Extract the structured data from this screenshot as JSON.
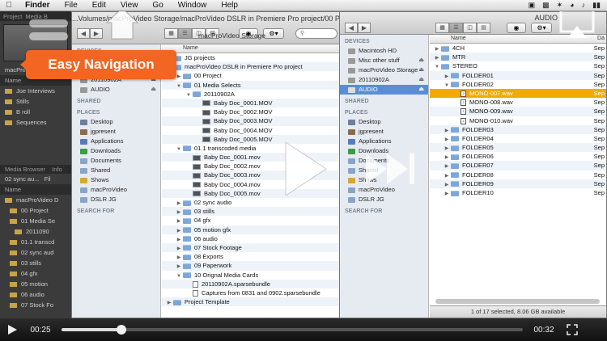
{
  "menubar": {
    "apple": "",
    "items": [
      "Finder",
      "File",
      "Edit",
      "View",
      "Go",
      "Window",
      "Help"
    ]
  },
  "premiere": {
    "tabs": [
      "Project",
      "Media B"
    ],
    "clip_label": "macProV...s in Premie",
    "name_header": "Name",
    "bins": [
      "Joe Interviews",
      "Stills",
      "B roll",
      "Sequences"
    ],
    "media_browser_tab": "Media Browser",
    "info_tab": "Info",
    "sync_dropdown": "02 sync au...",
    "filter_label": "Fil",
    "name_header2": "Name",
    "tree": [
      "macProVideo D",
      "00 Project",
      "01 Media Se",
      "2011090",
      "01.1 transcd",
      "02 sync aud",
      "03 stills",
      "04 gfx",
      "05 motion",
      "06 audio",
      "07 Stock Fo"
    ]
  },
  "finder1": {
    "path_title": "...Volumes/macProVideo Storage/macProVideo DSLR in Premiere Pro project/00 Proj",
    "title": "macProVideo Storage",
    "column_name": "Name",
    "sidebar": {
      "devices_label": "DEVICES",
      "devices": [
        "20110902A",
        "AUDIO"
      ],
      "shared_label": "SHARED",
      "places_label": "PLACES",
      "places": [
        "Desktop",
        "jgpresent",
        "Applications",
        "Downloads",
        "Documents",
        "Shared",
        "Shows",
        "macProVideo",
        "DSLR JG"
      ],
      "search_label": "SEARCH FOR"
    },
    "rows": [
      {
        "indent": 0,
        "tri": "▶",
        "icon": "folder",
        "label": "JG projects"
      },
      {
        "indent": 0,
        "tri": "▼",
        "icon": "folder",
        "label": "macProVideo DSLR in Premiere Pro project"
      },
      {
        "indent": 1,
        "tri": "▶",
        "icon": "folder",
        "label": "00 Project"
      },
      {
        "indent": 1,
        "tri": "▼",
        "icon": "folder",
        "label": "01 Media Selects"
      },
      {
        "indent": 2,
        "tri": "▼",
        "icon": "folder",
        "label": "20110902A"
      },
      {
        "indent": 3,
        "tri": "",
        "icon": "movie",
        "label": "Baby Doc_0001.MOV"
      },
      {
        "indent": 3,
        "tri": "",
        "icon": "movie",
        "label": "Baby Doc_0002.MOV"
      },
      {
        "indent": 3,
        "tri": "",
        "icon": "movie",
        "label": "Baby Doc_0003.MOV"
      },
      {
        "indent": 3,
        "tri": "",
        "icon": "movie",
        "label": "Baby Doc_0004.MOV"
      },
      {
        "indent": 3,
        "tri": "",
        "icon": "movie",
        "label": "Baby Doc_0005.MOV"
      },
      {
        "indent": 1,
        "tri": "▼",
        "icon": "folder",
        "label": "01.1 transcoded media"
      },
      {
        "indent": 2,
        "tri": "",
        "icon": "movie",
        "label": "Baby Doc_0001.mov"
      },
      {
        "indent": 2,
        "tri": "",
        "icon": "movie",
        "label": "Baby Doc_0002.mov"
      },
      {
        "indent": 2,
        "tri": "",
        "icon": "movie",
        "label": "Baby Doc_0003.mov"
      },
      {
        "indent": 2,
        "tri": "",
        "icon": "movie",
        "label": "Baby Doc_0004.mov"
      },
      {
        "indent": 2,
        "tri": "",
        "icon": "movie",
        "label": "Baby Doc_0005.mov"
      },
      {
        "indent": 1,
        "tri": "▶",
        "icon": "folder",
        "label": "02 sync audio"
      },
      {
        "indent": 1,
        "tri": "▶",
        "icon": "folder",
        "label": "03 stills"
      },
      {
        "indent": 1,
        "tri": "▶",
        "icon": "folder",
        "label": "04 gfx"
      },
      {
        "indent": 1,
        "tri": "▶",
        "icon": "folder",
        "label": "05 motion gfx"
      },
      {
        "indent": 1,
        "tri": "▶",
        "icon": "folder",
        "label": "06 audio"
      },
      {
        "indent": 1,
        "tri": "▶",
        "icon": "folder",
        "label": "07 Stock Footage"
      },
      {
        "indent": 1,
        "tri": "▶",
        "icon": "folder",
        "label": "08 Exports"
      },
      {
        "indent": 1,
        "tri": "▶",
        "icon": "folder",
        "label": "09 Paperwork"
      },
      {
        "indent": 1,
        "tri": "▼",
        "icon": "folder",
        "label": "10 Orignal Media Cards"
      },
      {
        "indent": 2,
        "tri": "",
        "icon": "doc",
        "label": "20110902A.sparsebundle"
      },
      {
        "indent": 2,
        "tri": "",
        "icon": "doc",
        "label": "Captures from 0831 and 0902.sparsebundle"
      },
      {
        "indent": 0,
        "tri": "▶",
        "icon": "folder",
        "label": "Project Template"
      }
    ]
  },
  "finder2": {
    "title": "AUDIO",
    "column_name": "Name",
    "column_date": "Da",
    "sidebar": {
      "devices_label": "DEVICES",
      "devices": [
        "Macintosh HD",
        "Misc other stuff",
        "macProVideo Storage",
        "20110902A",
        "AUDIO"
      ],
      "shared_label": "SHARED",
      "places_label": "PLACES",
      "places": [
        "Desktop",
        "jgpresent",
        "Applications",
        "Downloads",
        "Documents",
        "Shared",
        "Shows",
        "macProVideo",
        "DSLR JG"
      ],
      "search_label": "SEARCH FOR"
    },
    "rows": [
      {
        "indent": 0,
        "tri": "▶",
        "icon": "folder",
        "label": "4CH",
        "date": "Sep"
      },
      {
        "indent": 0,
        "tri": "▶",
        "icon": "folder",
        "label": "MTR",
        "date": "Sep"
      },
      {
        "indent": 0,
        "tri": "▼",
        "icon": "folder",
        "label": "STEREO",
        "date": "Sep"
      },
      {
        "indent": 1,
        "tri": "▶",
        "icon": "folder",
        "label": "FOLDER01",
        "date": "Sep"
      },
      {
        "indent": 1,
        "tri": "▼",
        "icon": "folder",
        "label": "FOLDER02",
        "date": "Sep"
      },
      {
        "indent": 2,
        "tri": "",
        "icon": "wav",
        "label": "MONO-007.wav",
        "date": "Sep",
        "hl": true
      },
      {
        "indent": 2,
        "tri": "",
        "icon": "wav",
        "label": "MONO-008.wav",
        "date": "Sep"
      },
      {
        "indent": 2,
        "tri": "",
        "icon": "wav",
        "label": "MONO-009.wav",
        "date": "Sep"
      },
      {
        "indent": 2,
        "tri": "",
        "icon": "wav",
        "label": "MONO-010.wav",
        "date": "Sep"
      },
      {
        "indent": 1,
        "tri": "▶",
        "icon": "folder",
        "label": "FOLDER03",
        "date": "Sep"
      },
      {
        "indent": 1,
        "tri": "▶",
        "icon": "folder",
        "label": "FOLDER04",
        "date": "Sep"
      },
      {
        "indent": 1,
        "tri": "▶",
        "icon": "folder",
        "label": "FOLDER05",
        "date": "Sep"
      },
      {
        "indent": 1,
        "tri": "▶",
        "icon": "folder",
        "label": "FOLDER06",
        "date": "Sep"
      },
      {
        "indent": 1,
        "tri": "▶",
        "icon": "folder",
        "label": "FOLDER07",
        "date": "Sep"
      },
      {
        "indent": 1,
        "tri": "▶",
        "icon": "folder",
        "label": "FOLDER08",
        "date": "Sep"
      },
      {
        "indent": 1,
        "tri": "▶",
        "icon": "folder",
        "label": "FOLDER09",
        "date": "Sep"
      },
      {
        "indent": 1,
        "tri": "▶",
        "icon": "folder",
        "label": "FOLDER10",
        "date": "Sep"
      }
    ],
    "status": "1 of 17 selected, 8.06 GB available"
  },
  "overlay": {
    "callout": "Easy Navigation",
    "callout_color": "#f26522",
    "icons": [
      "home-icon",
      "play-icon",
      "fast-forward-icon",
      "airplay-icon"
    ]
  },
  "player": {
    "elapsed": "00:25",
    "remaining": "00:32",
    "progress": 0.13
  }
}
